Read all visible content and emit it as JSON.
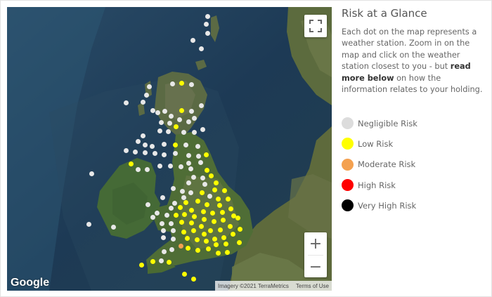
{
  "panel": {
    "title": "Risk at a Glance",
    "desc_before": "Each dot on the map represents a weather station. Zoom in on the map and click on the weather station closest to you - but ",
    "desc_bold": "read more below",
    "desc_after": " on how the information relates to your holding."
  },
  "legend": [
    {
      "label": "Negligible Risk",
      "color": "#dcdcdc"
    },
    {
      "label": "Low Risk",
      "color": "#ffff00"
    },
    {
      "label": "Moderate Risk",
      "color": "#f4a150"
    },
    {
      "label": "High Risk",
      "color": "#ff0000"
    },
    {
      "label": "Very High Risk",
      "color": "#000000"
    }
  ],
  "map": {
    "zoom_in_label": "+",
    "zoom_out_label": "−",
    "google_label": "Google",
    "imagery_label": "Imagery ©2021 TerraMetrics",
    "terms_label": "Terms of Use",
    "icons": {
      "fullscreen": "fullscreen-icon"
    }
  }
}
